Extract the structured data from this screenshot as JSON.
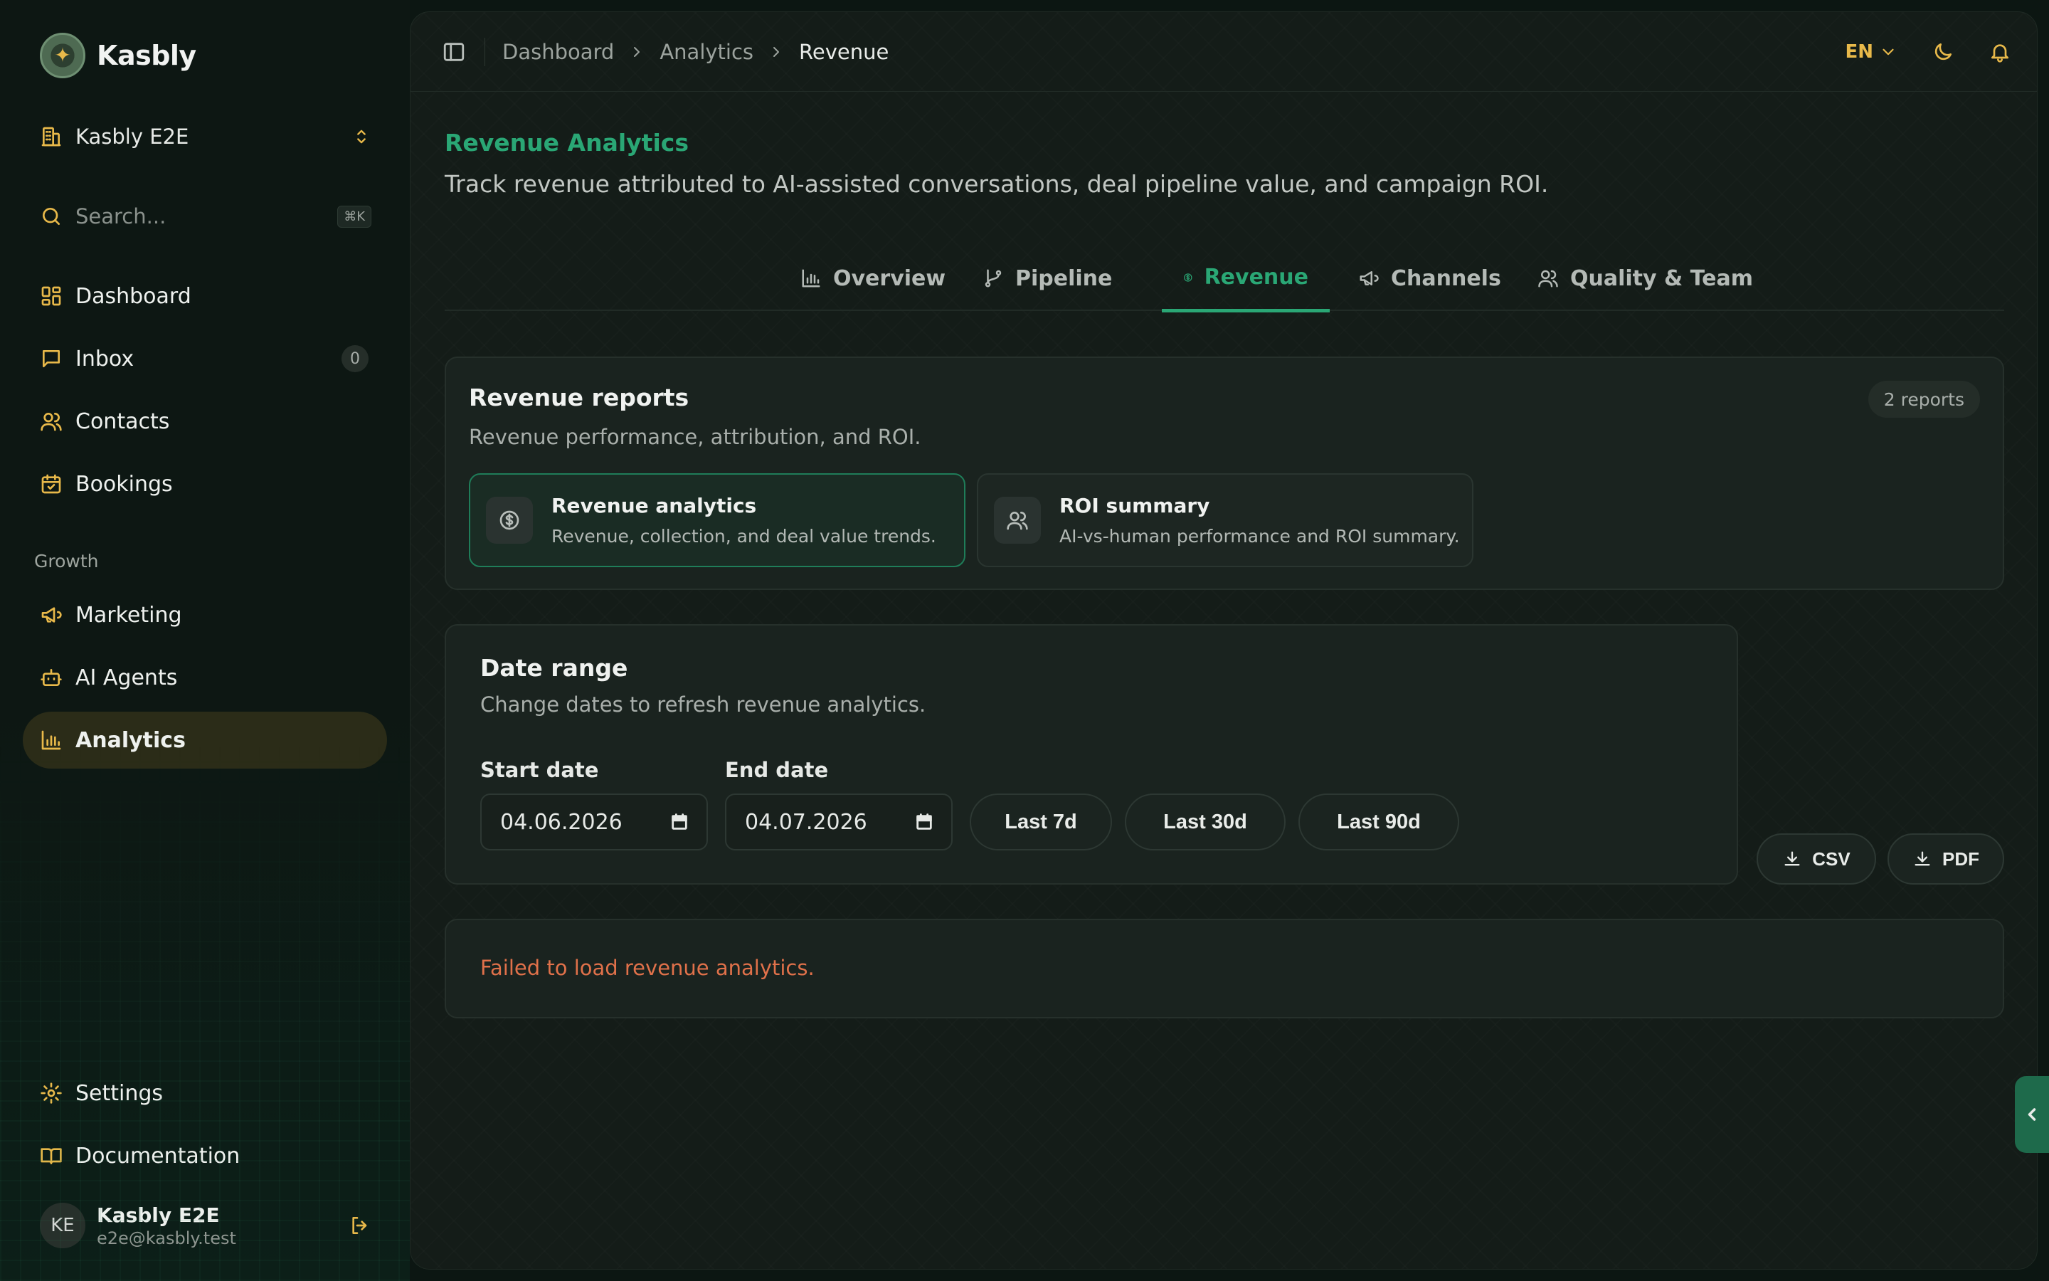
{
  "app": {
    "brand": "Kasbly",
    "workspace": "Kasbly E2E",
    "search_placeholder": "Search...",
    "search_shortcut": "⌘K"
  },
  "sidebar": {
    "main_items": [
      {
        "label": "Dashboard",
        "icon": "dashboard-icon"
      },
      {
        "label": "Inbox",
        "icon": "inbox-icon",
        "badge": "0"
      },
      {
        "label": "Contacts",
        "icon": "contacts-icon"
      },
      {
        "label": "Bookings",
        "icon": "calendar-icon"
      }
    ],
    "section_label": "Growth",
    "growth_items": [
      {
        "label": "Marketing",
        "icon": "megaphone-icon"
      },
      {
        "label": "AI Agents",
        "icon": "bot-icon"
      },
      {
        "label": "Analytics",
        "icon": "bar-chart-icon",
        "active": true
      }
    ],
    "footer_items": [
      {
        "label": "Settings",
        "icon": "gear-icon"
      },
      {
        "label": "Documentation",
        "icon": "book-icon"
      }
    ],
    "user": {
      "initials": "KE",
      "name": "Kasbly E2E",
      "email": "e2e@kasbly.test"
    }
  },
  "topbar": {
    "breadcrumbs": [
      "Dashboard",
      "Analytics",
      "Revenue"
    ],
    "language": "EN"
  },
  "page": {
    "title": "Revenue Analytics",
    "subtitle": "Track revenue attributed to AI-assisted conversations, deal pipeline value, and campaign ROI."
  },
  "tabs": [
    {
      "label": "Overview",
      "icon": "bar-chart-icon"
    },
    {
      "label": "Pipeline",
      "icon": "git-branch-icon"
    },
    {
      "label": "Revenue",
      "icon": "dollar-circle-icon",
      "active": true
    },
    {
      "label": "Channels",
      "icon": "megaphone-icon"
    },
    {
      "label": "Quality & Team",
      "icon": "users-icon"
    }
  ],
  "reports": {
    "title": "Revenue reports",
    "subtitle": "Revenue performance, attribution, and ROI.",
    "count": "2 reports",
    "items": [
      {
        "title": "Revenue analytics",
        "description": "Revenue, collection, and deal value trends.",
        "icon": "dollar-circle-icon",
        "selected": true
      },
      {
        "title": "ROI summary",
        "description": "AI-vs-human performance and ROI summary.",
        "icon": "users-icon"
      }
    ]
  },
  "date_range": {
    "title": "Date range",
    "subtitle": "Change dates to refresh revenue analytics.",
    "start_label": "Start date",
    "start_value": "04.06.2026",
    "end_label": "End date",
    "end_value": "04.07.2026",
    "presets": [
      "Last 7d",
      "Last 30d",
      "Last 90d"
    ]
  },
  "export": {
    "csv": "CSV",
    "pdf": "PDF"
  },
  "error": {
    "message": "Failed to load revenue analytics."
  },
  "colors": {
    "accent_green": "#2aa775",
    "accent_gold": "#e8b94a",
    "error": "#e0714a"
  }
}
